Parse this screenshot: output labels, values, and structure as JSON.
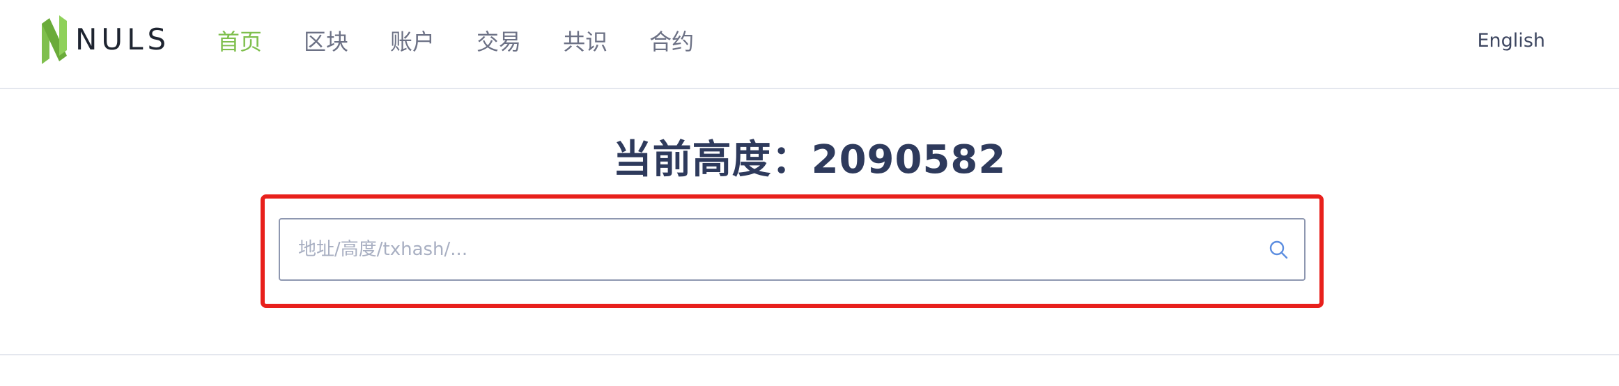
{
  "logo": {
    "text": "NULS",
    "icon": "nuls-logo-icon",
    "accent_color": "#7fbf4d"
  },
  "nav": {
    "items": [
      {
        "label": "首页",
        "active": true
      },
      {
        "label": "区块",
        "active": false
      },
      {
        "label": "账户",
        "active": false
      },
      {
        "label": "交易",
        "active": false
      },
      {
        "label": "共识",
        "active": false
      },
      {
        "label": "合约",
        "active": false
      }
    ],
    "active_color": "#7fbf4d"
  },
  "language": {
    "label": "English"
  },
  "main": {
    "height_label": "当前高度：2090582"
  },
  "search": {
    "value": "",
    "placeholder": "地址/高度/txhash/...",
    "icon": "search-icon",
    "icon_color": "#5b8de0"
  },
  "highlight": {
    "color": "#e8201c"
  }
}
